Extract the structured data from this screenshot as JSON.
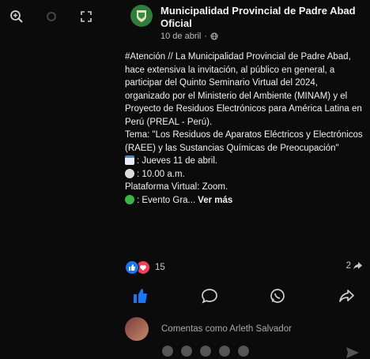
{
  "page": {
    "name": "Municipalidad Provincial de Padre Abad Oficial",
    "date": "10 de abril",
    "date_separator": "·"
  },
  "post": {
    "lines": [
      "#Atención // La Municipalidad Provincial de Padre Abad, hace extensiva la invitación, al público en general, a participar del Quinto Seminario Virtual del 2024, organizado por el Ministerio del Ambiente (MINAM) y el Proyecto de Residuos Electrónicos para América Latina en Perú (PREAL - Perú).",
      "Tema: \"Los Residuos de Aparatos Eléctricos y Electrónicos (RAEE) y las Sustancias Químicas de Preocupación\"",
      ": Jueves 11 de abril.",
      ": 10.00 a.m.",
      "Plataforma Virtual: Zoom.",
      ": Evento Gra..."
    ],
    "see_more": "Ver más"
  },
  "reactions": {
    "count": "15",
    "shares": "2"
  },
  "comment": {
    "placeholder": "Comentas como Arleth Salvador"
  },
  "icons": {
    "top": [
      "zoom-in-icon",
      "settings-icon",
      "expand-icon"
    ],
    "actions": [
      "like-icon",
      "comment-icon",
      "whatsapp-icon",
      "share-icon"
    ]
  },
  "colors": {
    "background": "#0b0b0c",
    "like": "#1877f2",
    "love": "#f33e58",
    "avatar": "#2f7d3a"
  }
}
